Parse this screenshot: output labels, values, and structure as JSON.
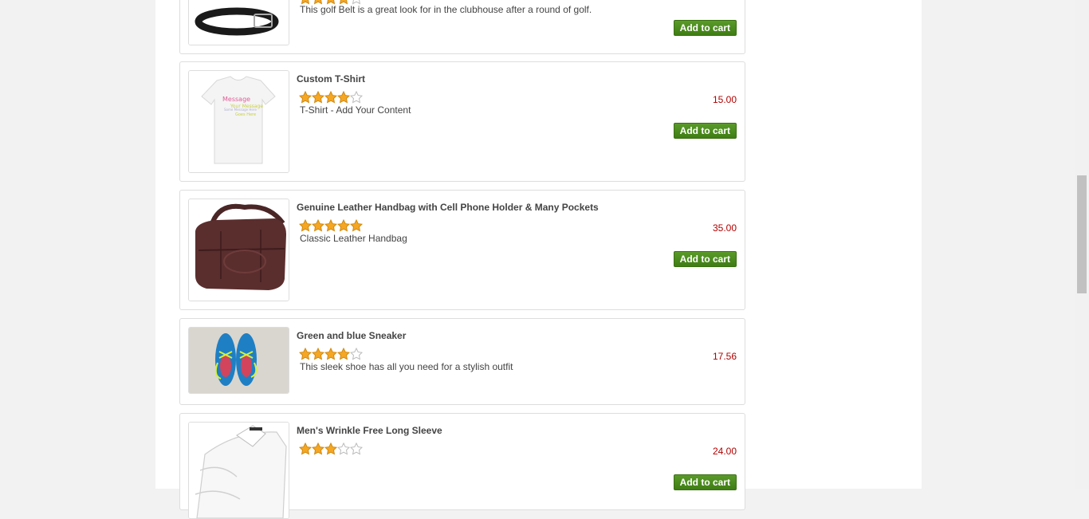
{
  "products": [
    {
      "title": "",
      "rating": 4,
      "description": "This golf Belt is a great look for in the clubhouse after a round of golf.",
      "price": "",
      "add_label": "Add to cart",
      "image": "golf-belt-image"
    },
    {
      "title": "Custom T-Shirt",
      "rating": 4,
      "description": "T-Shirt - Add Your Content",
      "price": "15.00",
      "add_label": "Add to cart",
      "image": "custom-tshirt-image"
    },
    {
      "title": "Genuine Leather Handbag with Cell Phone Holder & Many Pockets",
      "rating": 5,
      "description": "Classic Leather Handbag",
      "price": "35.00",
      "add_label": "Add to cart",
      "image": "leather-handbag-image"
    },
    {
      "title": "Green and blue Sneaker",
      "rating": 4,
      "description": "This sleek shoe has all you need for a stylish outfit",
      "price": "17.56",
      "add_label": "",
      "image": "sneaker-image"
    },
    {
      "title": "Men's Wrinkle Free Long Sleeve",
      "rating": 3,
      "description": "",
      "price": "24.00",
      "add_label": "Add to cart",
      "image": "dress-shirt-image"
    }
  ],
  "colors": {
    "price": "#b00000",
    "button": "#4a8a1e",
    "star_filled": "#f5a623",
    "star_empty": "#dddddd"
  }
}
